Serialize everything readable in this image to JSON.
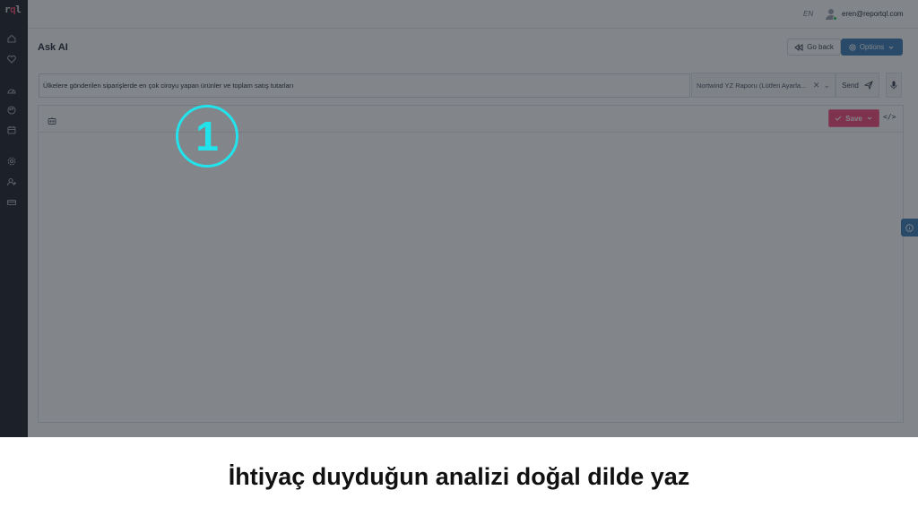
{
  "sidebar": {
    "logo_prefix": "r",
    "logo_q": "q",
    "logo_suffix": "l",
    "items": [
      "home-icon",
      "heart-icon",
      "dashboard-icon",
      "palette-icon",
      "calendar-icon",
      "gear-icon",
      "user-add-icon",
      "card-icon"
    ]
  },
  "topbar": {
    "language": "EN",
    "user_email": "eren@reportql.com"
  },
  "page": {
    "title": "Ask AI",
    "go_back_label": "Go back",
    "options_label": "Options"
  },
  "query": {
    "value": "Ülkelere gönderilen siparişlerde en çok ciroyu yapan ürünler ve toplam satış tutarları",
    "report_selected": "Nortwind YZ Raporu (Lütfen Ayarla...",
    "send_label": "Send"
  },
  "result": {
    "save_label": "Save",
    "code_label": "</>"
  },
  "annotation": {
    "step_number": "1",
    "caption": "İhtiyaç duyduğun analizi doğal dilde yaz"
  },
  "colors": {
    "sidebar_bg": "#1d222c",
    "primary": "#3b7db8",
    "save": "#f5477a",
    "badge": "#22e3ec"
  }
}
